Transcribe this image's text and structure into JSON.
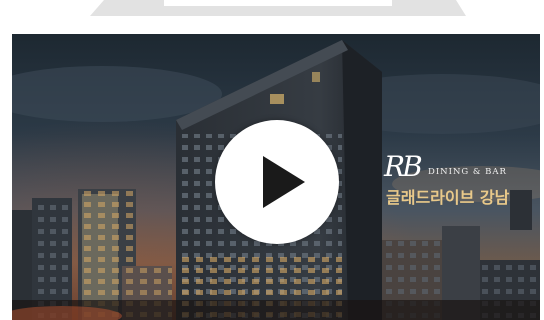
{
  "logo": {
    "monogram": "RB",
    "subtitle": "DINING & BAR",
    "name_kr": "글래드라이브 강남"
  },
  "player": {
    "control_icon": "play-icon",
    "play_button_color": "#ffffff",
    "icon_color": "#1a1a1a"
  },
  "colors": {
    "logo_gold": "#e9c98a",
    "sky_dark": "#1b2630"
  }
}
